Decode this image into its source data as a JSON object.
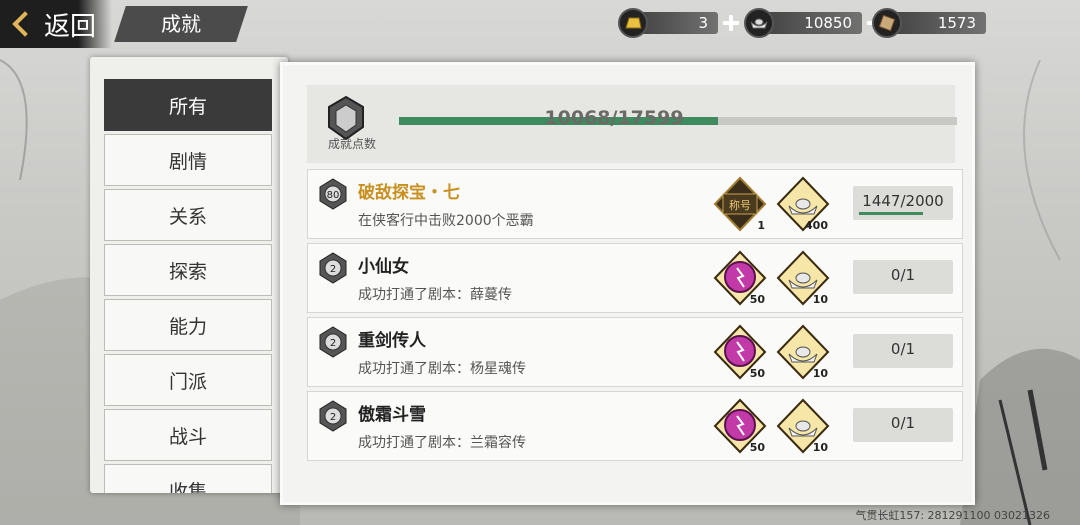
{
  "header": {
    "back_label": "返回",
    "page_tab": "成就",
    "currencies": [
      {
        "icon": "gold-bar-icon",
        "value": "3"
      },
      {
        "icon": "silver-ingot-icon",
        "value": "10850"
      },
      {
        "icon": "scroll-icon",
        "value": "1573"
      }
    ]
  },
  "categories": [
    "所有",
    "剧情",
    "关系",
    "探索",
    "能力",
    "门派",
    "战斗",
    "收集"
  ],
  "active_category": 0,
  "summary": {
    "label": "成就点数",
    "progress_text": "10068/17599",
    "current": 10068,
    "total": 17599
  },
  "achievements": [
    {
      "badge_level": "80",
      "title": "破敌探宝・七",
      "title_color": "#c8901f",
      "desc": "在侠客行中击败2000个恶霸",
      "rewards": [
        {
          "icon": "title-plaque-icon",
          "text": "称号",
          "count": "1"
        },
        {
          "icon": "silver-ingot-icon",
          "count": "400"
        }
      ],
      "progress": "1447/2000",
      "fraction": 0.7235
    },
    {
      "badge_level": "2",
      "title": "小仙女",
      "title_color": "#222222",
      "desc": "成功打通了剧本：薛蔓传",
      "rewards": [
        {
          "icon": "purple-orb-icon",
          "count": "50"
        },
        {
          "icon": "silver-ingot-icon",
          "count": "10"
        }
      ],
      "progress": "0/1",
      "fraction": 0
    },
    {
      "badge_level": "2",
      "title": "重剑传人",
      "title_color": "#222222",
      "desc": "成功打通了剧本：杨星魂传",
      "rewards": [
        {
          "icon": "purple-orb-icon",
          "count": "50"
        },
        {
          "icon": "silver-ingot-icon",
          "count": "10"
        }
      ],
      "progress": "0/1",
      "fraction": 0
    },
    {
      "badge_level": "2",
      "title": "傲霜斗雪",
      "title_color": "#222222",
      "desc": "成功打通了剧本：兰霜容传",
      "rewards": [
        {
          "icon": "purple-orb-icon",
          "count": "50"
        },
        {
          "icon": "silver-ingot-icon",
          "count": "10"
        }
      ],
      "progress": "0/1",
      "fraction": 0
    }
  ],
  "footer": {
    "player_id": "气贯长虹157: 281291100 03021326"
  }
}
